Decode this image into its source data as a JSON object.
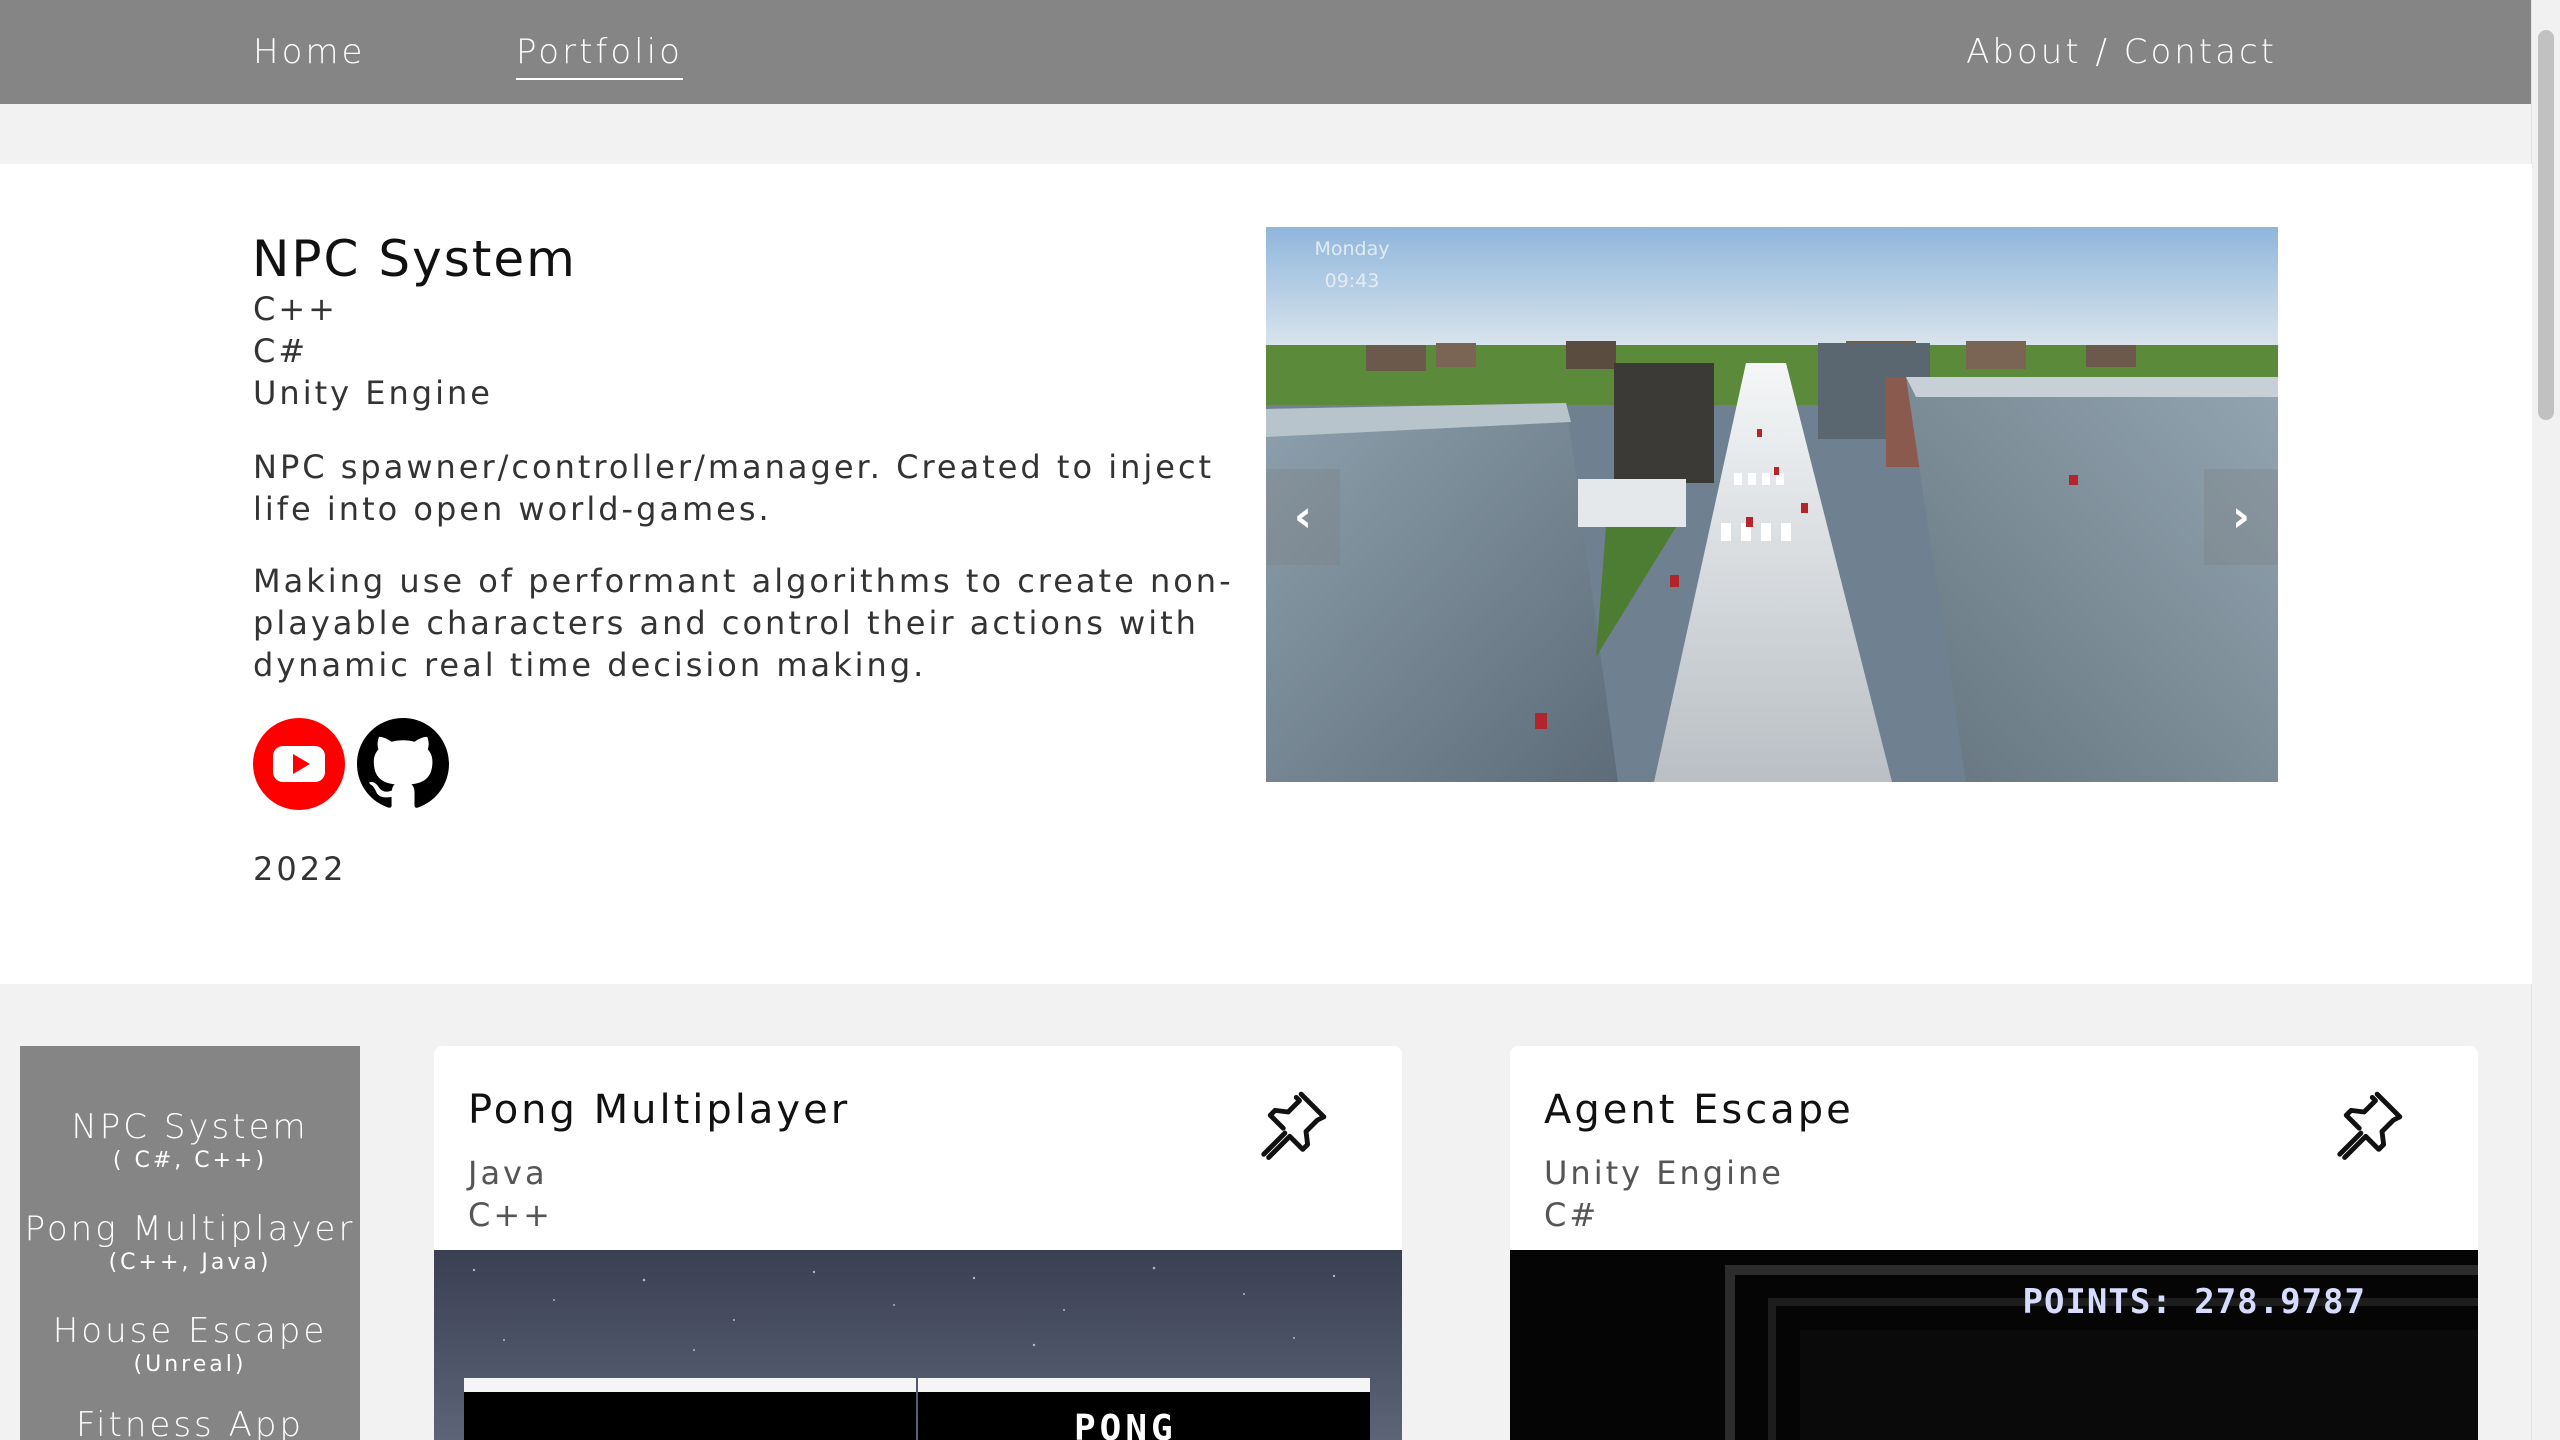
{
  "nav": {
    "home": "Home",
    "portfolio": "Portfolio",
    "about": "About / Contact"
  },
  "featured": {
    "title": "NPC System",
    "tech": [
      "C++",
      "C#",
      "Unity Engine"
    ],
    "description": [
      "NPC spawner/controller/manager. Created to inject life into open world-games.",
      "Making use of performant algorithms to create non-playable characters and control their actions with dynamic real time decision making."
    ],
    "year": "2022",
    "carousel": {
      "overlay_day": "Monday",
      "overlay_time": "09:43",
      "prev": "‹",
      "next": "›"
    }
  },
  "sidebar": {
    "items": [
      {
        "name": "NPC System",
        "tech": "( C#, C++)"
      },
      {
        "name": "Pong Multiplayer",
        "tech": "(C++, Java)"
      },
      {
        "name": "House Escape",
        "tech": "(Unreal)"
      },
      {
        "name": "Fitness App",
        "tech": ""
      }
    ]
  },
  "cards": [
    {
      "title": "Pong Multiplayer",
      "tech": [
        "Java",
        "C++"
      ],
      "image_text": "PONG"
    },
    {
      "title": "Agent Escape",
      "tech": [
        "Unity Engine",
        "C#"
      ],
      "image_text": "POINTS: 278.9787"
    }
  ],
  "icons": {
    "youtube": "youtube-icon",
    "github": "github-icon",
    "pin": "pin-icon"
  },
  "colors": {
    "nav_bg": "#858585",
    "youtube_red": "#ff0000",
    "page_bg": "#f2f2f2"
  }
}
